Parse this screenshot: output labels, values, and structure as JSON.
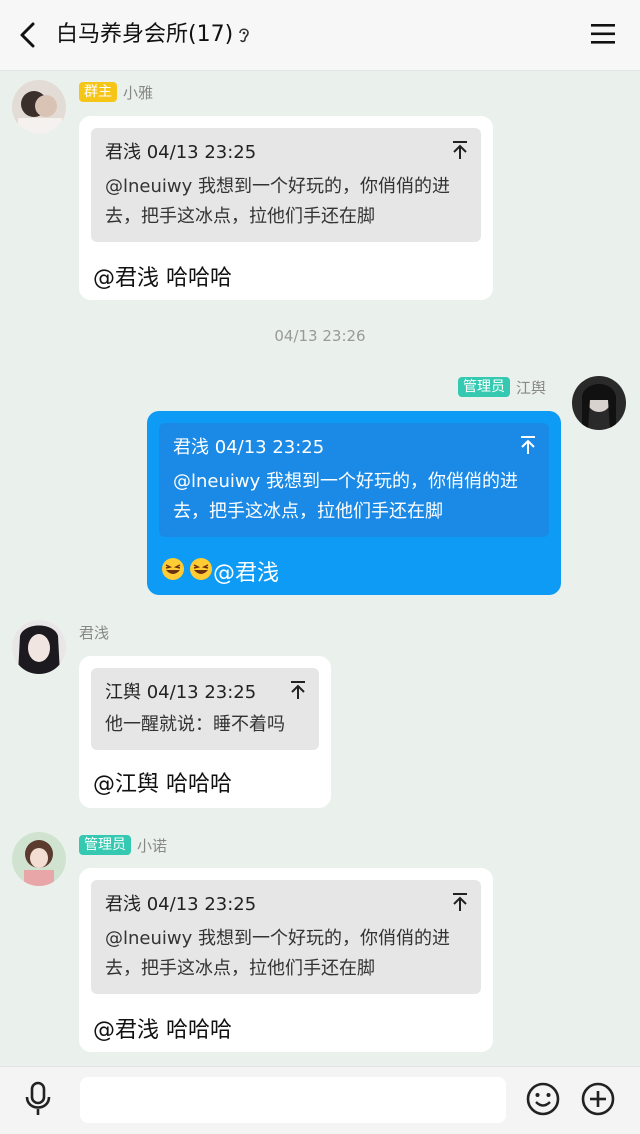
{
  "header": {
    "title": "白马养身会所(17)"
  },
  "timestamp": "04/13 23:26",
  "messages": [
    {
      "badge": "群主",
      "nick": "小雅",
      "quote_head": "君浅 04/13 23:25",
      "quote_line1": "@lneuiwy 我想到一个好玩的，你俏俏的进",
      "quote_line2": "去，把手这冰点，拉他们手还在脚",
      "text": "@君浅 哈哈哈"
    },
    {
      "badge": "管理员",
      "nick": "江舆",
      "quote_head": "君浅 04/13 23:25",
      "quote_line1": "@lneuiwy 我想到一个好玩的，你俏俏的进",
      "quote_line2": "去，把手这冰点，拉他们手还在脚",
      "text": "@君浅"
    },
    {
      "nick": "君浅",
      "quote_head": "江舆 04/13 23:25",
      "quote_line1": "他一醒就说：睡不着吗",
      "text": "@江舆 哈哈哈"
    },
    {
      "badge": "管理员",
      "nick": "小诺",
      "quote_head": "君浅 04/13 23:25",
      "quote_line1": "@lneuiwy 我想到一个好玩的，你俏俏的进",
      "quote_line2": "去，把手这冰点，拉他们手还在脚",
      "text": "@君浅 哈哈哈"
    }
  ],
  "icons": [
    "back-arrow-icon",
    "ear-icon",
    "menu-icon",
    "pin-top-icon",
    "laugh-emoji-icon",
    "mic-icon",
    "emoji-icon",
    "plus-icon"
  ],
  "colors": {
    "self_bubble": "#0d9bf5",
    "owner_badge": "#f5c518",
    "admin_badge": "#34c9b0"
  }
}
